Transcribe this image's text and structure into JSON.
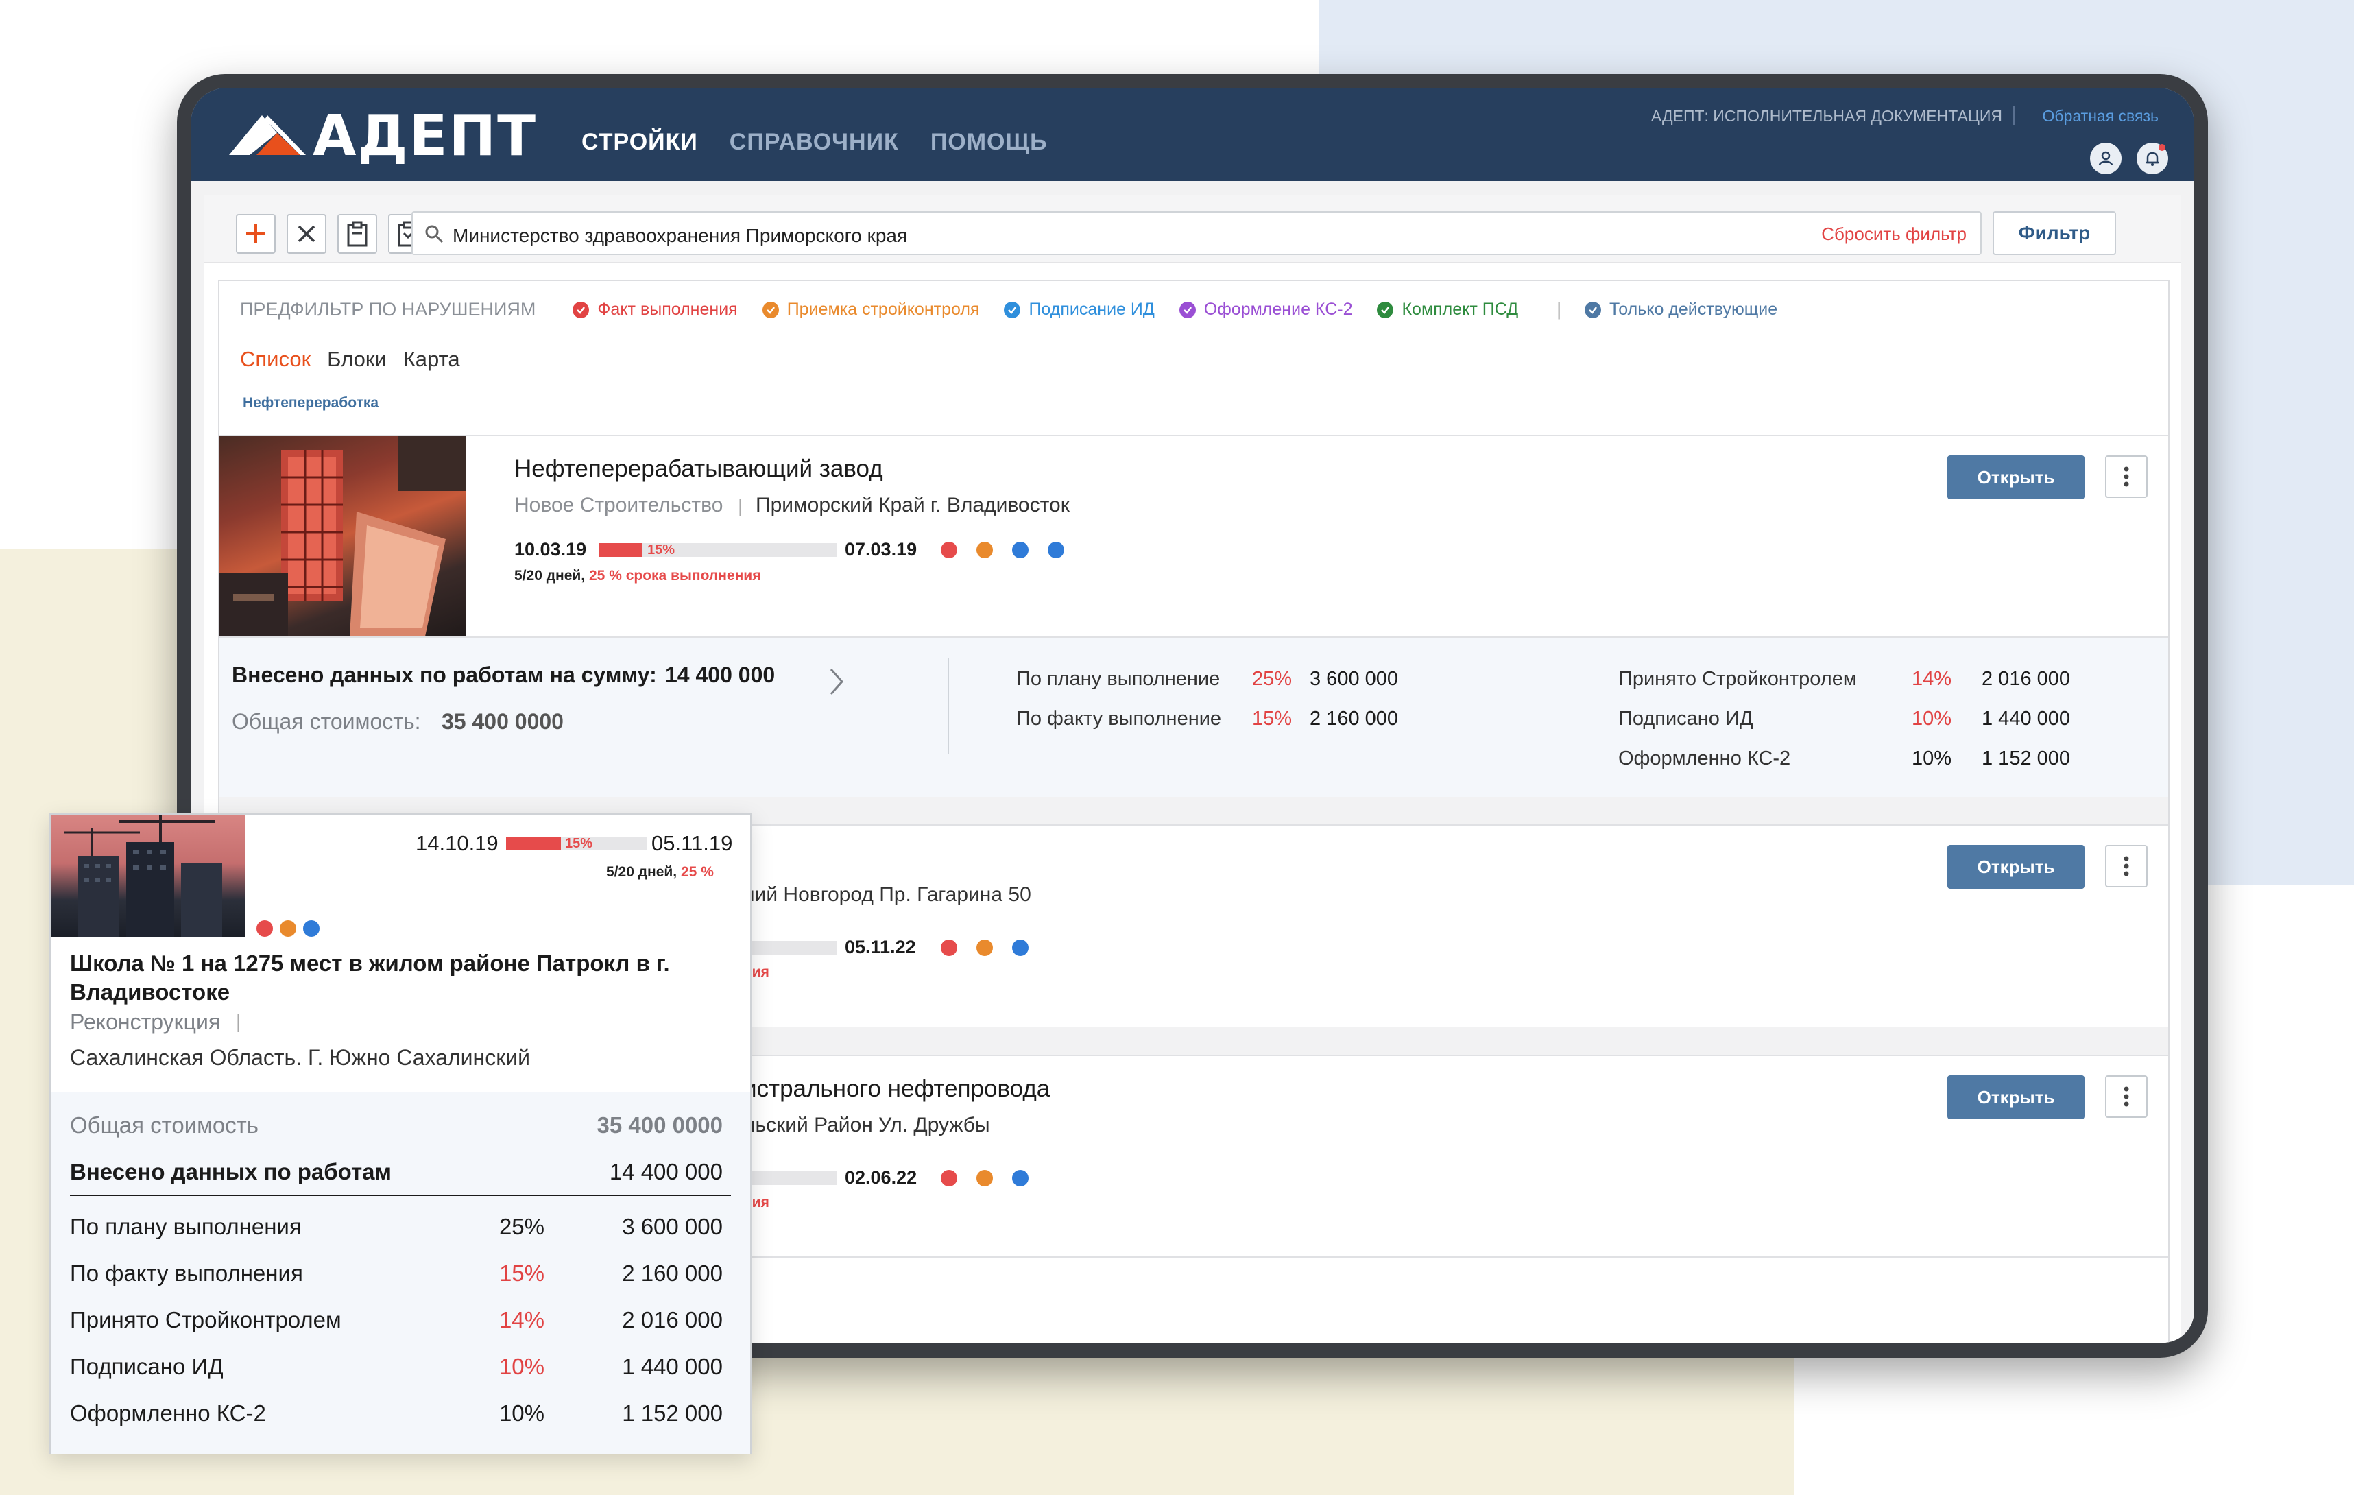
{
  "header": {
    "logo_text": "АДЕПТ",
    "nav": [
      "СТРОЙКИ",
      "СПРАВОЧНИК",
      "ПОМОЩЬ"
    ],
    "app_title": "АДЕПТ: ИСПОЛНИТЕЛЬНАЯ ДОКУМЕНТАЦИЯ",
    "feedback": "Обратная связь"
  },
  "toolbar": {
    "search_value": "Министерство здравоохранения Приморского края",
    "reset_filter": "Сбросить фильтр",
    "filter_button": "Фильтр"
  },
  "prefilter": {
    "title": "ПРЕДФИЛЬТР ПО НАРУШЕНИЯМ",
    "chips": [
      {
        "label": "Факт выполнения",
        "color": "#e14343"
      },
      {
        "label": "Приемка стройконтроля",
        "color": "#e98a2d"
      },
      {
        "label": "Подписание ИД",
        "color": "#2f8fdc"
      },
      {
        "label": "Оформление КС-2",
        "color": "#9a4fd4"
      },
      {
        "label": "Комплект ПСД",
        "color": "#2e8b3e"
      }
    ],
    "only_active": {
      "label": "Только действующие",
      "color": "#4f79a4"
    },
    "separator": "|"
  },
  "views": [
    "Список",
    "Блоки",
    "Карта"
  ],
  "tag": "Нефтепереработка",
  "cards": [
    {
      "title": "Нефтеперерабатывающий завод",
      "type": "Новое Строительство",
      "address": "Приморский Край г. Владивосток",
      "date_start": "10.03.19",
      "date_end": "07.03.19",
      "progress_label": "15%",
      "progress": 0.15,
      "days": "5/20 дней,",
      "days_pct": "25 % срока выполнения",
      "open": "Открыть"
    },
    {
      "address_visible": "ний Новгород Пр. Гагарина 50",
      "date_end": "05.11.22",
      "days_fragment": "ния",
      "open": "Открыть"
    },
    {
      "title_visible": "истрального нефтепровода",
      "address_visible": "льский Район Ул. Дружбы",
      "date_end": "02.06.22",
      "days_fragment": "ния",
      "open": "Открыть"
    }
  ],
  "summary": {
    "entered_label": "Внесено данных по работам на сумму:",
    "entered_value": "14 400 000",
    "total_label": "Общая стоимость:",
    "total_value": "35 400 0000",
    "stats_left": [
      {
        "label": "По плану выполнение",
        "pct": "25%",
        "value": "3 600 000",
        "color": "#e14343"
      },
      {
        "label": "По факту выполнение",
        "pct": "15%",
        "value": "2 160 000",
        "color": "#e14343"
      }
    ],
    "stats_right": [
      {
        "label": "Принято Стройконтролем",
        "pct": "14%",
        "value": "2 016 000",
        "color": "#e14343"
      },
      {
        "label": "Подписано ИД",
        "pct": "10%",
        "value": "1 440 000",
        "color": "#e14343"
      },
      {
        "label": "Оформленно КС-2",
        "pct": "10%",
        "value": "1 152 000",
        "color": "#1b1b1b"
      }
    ]
  },
  "overlay": {
    "date_start": "14.10.19",
    "date_end": "05.11.19",
    "progress_label": "15%",
    "progress": 0.15,
    "days": "5/20 дней,",
    "days_pct": "25 %",
    "title": "Школа № 1 на 1275 мест в жилом районе Патрокл в г. Владивостоке",
    "type": "Реконструкция",
    "address": "Сахалинская Область. Г. Южно Сахалинский",
    "total_label": "Общая стоимость",
    "total_value": "35 400 0000",
    "entered_label": "Внесено данных по работам",
    "entered_value": "14 400 000",
    "rows": [
      {
        "label": "По плану выполнения",
        "pct": "25%",
        "value": "3 600 000",
        "color": "#1b1b1b"
      },
      {
        "label": "По факту выполнения",
        "pct": "15%",
        "value": "2 160 000",
        "color": "#e14343"
      },
      {
        "label": "Принято Стройконтролем",
        "pct": "14%",
        "value": "2 016 000",
        "color": "#e14343"
      },
      {
        "label": "Подписано ИД",
        "pct": "10%",
        "value": "1 440 000",
        "color": "#e14343"
      },
      {
        "label": "Оформленно КС-2",
        "pct": "10%",
        "value": "1 152 000",
        "color": "#1b1b1b"
      }
    ]
  },
  "status_colors": {
    "red": "#e64b4b",
    "orange": "#e98a2d",
    "blue": "#2f7bd8"
  }
}
